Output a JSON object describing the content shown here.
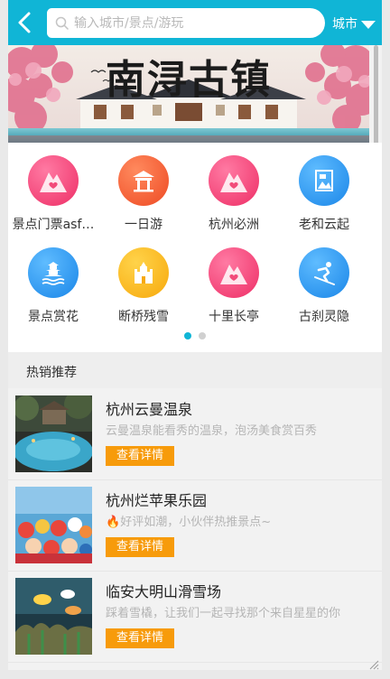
{
  "header": {
    "search_placeholder": "输入城市/景点/游玩",
    "city_label": "城市"
  },
  "banner": {
    "title": "南浔古镇"
  },
  "categories": [
    {
      "label": "景点门票asf…",
      "icon": "mountain-heart-icon",
      "color": "#f24b7a"
    },
    {
      "label": "一日游",
      "icon": "pavilion-icon",
      "color": "#f4613a"
    },
    {
      "label": "杭州必洲",
      "icon": "mountain-heart-icon",
      "color": "#f24b7a"
    },
    {
      "label": "老和云起",
      "icon": "flag-map-icon",
      "color": "#2a9cf1"
    },
    {
      "label": "景点赏花",
      "icon": "pagoda-icon",
      "color": "#2a9cf1"
    },
    {
      "label": "断桥残雪",
      "icon": "castle-icon",
      "color": "#fbb716"
    },
    {
      "label": "十里长亭",
      "icon": "mountain-heart-icon",
      "color": "#f24b7a"
    },
    {
      "label": "古刹灵隐",
      "icon": "skier-icon",
      "color": "#2a9cf1"
    }
  ],
  "pager": {
    "active_color": "#10b5d6",
    "inactive_color": "#d0d0d0"
  },
  "section": {
    "title": "热销推荐"
  },
  "hot_list": [
    {
      "title": "杭州云曼温泉",
      "desc": "云曼温泉能看秀的温泉，泡汤美食赏百秀",
      "button": "查看详情"
    },
    {
      "title": "杭州烂苹果乐园",
      "desc": "好评如潮，小伙伴热推景点~",
      "button": "查看详情"
    },
    {
      "title": "临安大明山滑雪场",
      "desc": "踩着雪橇，让我们一起寻找那个来自星星的你",
      "button": "查看详情"
    }
  ]
}
